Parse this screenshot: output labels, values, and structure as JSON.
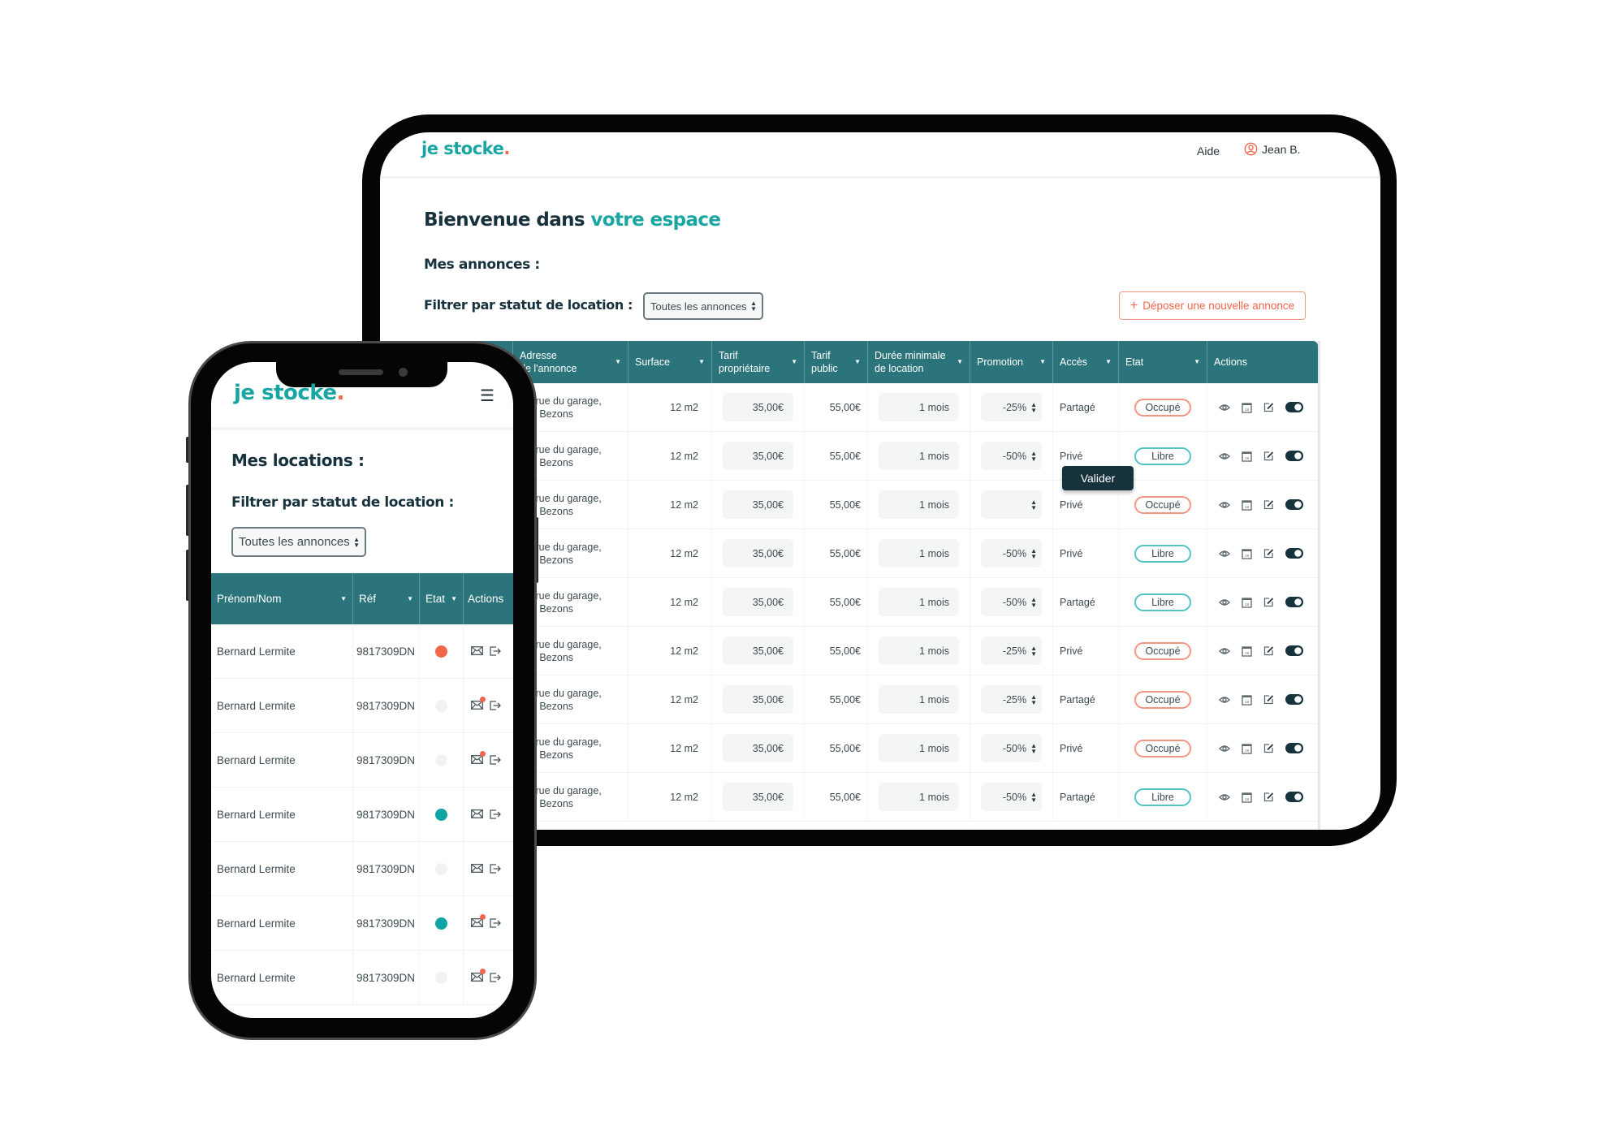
{
  "colors": {
    "brand_teal": "#19a6a3",
    "accent_orange": "#f2664b",
    "table_header": "#2b747b",
    "dark": "#15323d",
    "state_occupied": "#f2664b",
    "state_free": "#0fa3a3",
    "state_inactive": "#f2f2f2"
  },
  "tablet": {
    "logo": {
      "text": "je stocke",
      "dot": "."
    },
    "header": {
      "help": "Aide",
      "user": "Jean B.",
      "user_icon": "user-circle-icon"
    },
    "title": {
      "prefix": "Bienvenue dans ",
      "accent": "votre espace"
    },
    "section_title": "Mes annonces :",
    "filter_label": "Filtrer par statut de location :",
    "filter_value": "Toutes les annonces",
    "new_button": {
      "icon": "plus-icon",
      "label": "Déposer une nouvelle annonce"
    },
    "validate_tooltip": "Valider",
    "columns": [
      "",
      "Adresse|de l'annonce",
      "Surface",
      "Tarif|propriétaire",
      "Tarif|public",
      "Durée minimale|de location",
      "Promotion",
      "Accès",
      "Etat",
      "Actions"
    ],
    "rows": [
      {
        "address1": "bis rue du garage,",
        "address2": "063 Bezons",
        "surface": "12 m2",
        "owner_price": "35,00€",
        "public_price": "55,00€",
        "duration": "1 mois",
        "promo": "-25%",
        "access": "Partagé",
        "state": "Occupé"
      },
      {
        "address1": "bis rue du garage,",
        "address2": "063 Bezons",
        "surface": "12 m2",
        "owner_price": "35,00€",
        "public_price": "55,00€",
        "duration": "1 mois",
        "promo": "-50%",
        "access": "Privé",
        "state": "Libre"
      },
      {
        "address1": "bis rue du garage,",
        "address2": "063 Bezons",
        "surface": "12 m2",
        "owner_price": "35,00€",
        "public_price": "55,00€",
        "duration": "1 mois",
        "promo": "",
        "access": "Privé",
        "state": "Occupé"
      },
      {
        "address1": "bis rue du garage,",
        "address2": "063 Bezons",
        "surface": "12 m2",
        "owner_price": "35,00€",
        "public_price": "55,00€",
        "duration": "1 mois",
        "promo": "-50%",
        "access": "Privé",
        "state": "Libre"
      },
      {
        "address1": "bis rue du garage,",
        "address2": "063 Bezons",
        "surface": "12 m2",
        "owner_price": "35,00€",
        "public_price": "55,00€",
        "duration": "1 mois",
        "promo": "-50%",
        "access": "Partagé",
        "state": "Libre"
      },
      {
        "address1": "bis rue du garage,",
        "address2": "063 Bezons",
        "surface": "12 m2",
        "owner_price": "35,00€",
        "public_price": "55,00€",
        "duration": "1 mois",
        "promo": "-25%",
        "access": "Privé",
        "state": "Occupé"
      },
      {
        "address1": "bis rue du garage,",
        "address2": "063 Bezons",
        "surface": "12 m2",
        "owner_price": "35,00€",
        "public_price": "55,00€",
        "duration": "1 mois",
        "promo": "-25%",
        "access": "Partagé",
        "state": "Occupé"
      },
      {
        "address1": "bis rue du garage,",
        "address2": "063 Bezons",
        "surface": "12 m2",
        "owner_price": "35,00€",
        "public_price": "55,00€",
        "duration": "1 mois",
        "promo": "-50%",
        "access": "Privé",
        "state": "Occupé"
      },
      {
        "address1": "bis rue du garage,",
        "address2": "063 Bezons",
        "surface": "12 m2",
        "owner_price": "35,00€",
        "public_price": "55,00€",
        "duration": "1 mois",
        "promo": "-50%",
        "access": "Partagé",
        "state": "Libre"
      }
    ],
    "row_action_icons": [
      "eye-icon",
      "calendar-icon",
      "edit-icon",
      "toggle-on-icon"
    ]
  },
  "phone": {
    "logo": {
      "text": "je stocke",
      "dot": "."
    },
    "menu_icon": "hamburger-menu-icon",
    "section_title": "Mes locations :",
    "filter_label": "Filtrer par statut de location :",
    "filter_value": "Toutes les annonces",
    "columns": [
      "Prénom/Nom",
      "Réf",
      "Etat",
      "Actions"
    ],
    "rows": [
      {
        "name": "Bernard Lermite",
        "ref": "9817309DN",
        "state": "occupied",
        "unread": false
      },
      {
        "name": "Bernard Lermite",
        "ref": "9817309DN",
        "state": "inactive",
        "unread": true
      },
      {
        "name": "Bernard Lermite",
        "ref": "9817309DN",
        "state": "inactive",
        "unread": true
      },
      {
        "name": "Bernard Lermite",
        "ref": "9817309DN",
        "state": "free",
        "unread": false
      },
      {
        "name": "Bernard Lermite",
        "ref": "9817309DN",
        "state": "inactive",
        "unread": false
      },
      {
        "name": "Bernard Lermite",
        "ref": "9817309DN",
        "state": "free",
        "unread": true
      },
      {
        "name": "Bernard Lermite",
        "ref": "9817309DN",
        "state": "inactive",
        "unread": true
      }
    ],
    "row_action_icons": [
      "mail-icon",
      "logout-icon"
    ]
  }
}
